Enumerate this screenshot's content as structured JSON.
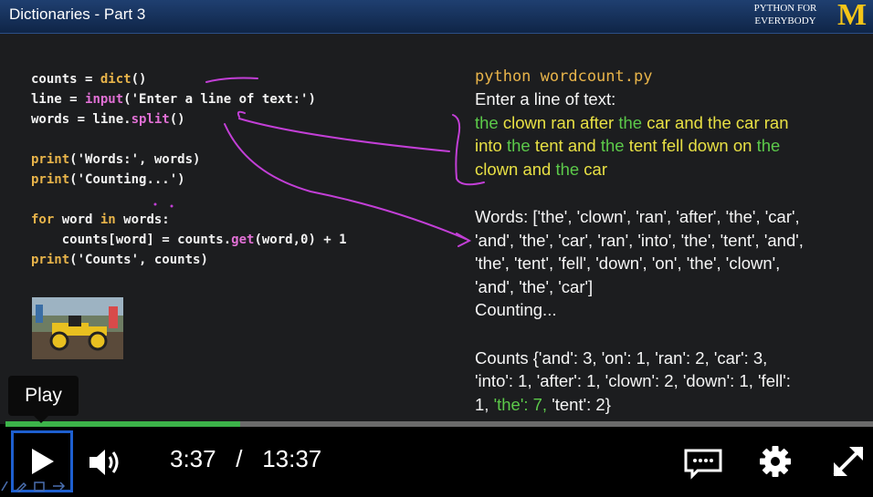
{
  "title_bar": {
    "title": "Dictionaries - Part 3",
    "brand_line1": "PYTHON FOR",
    "brand_line2": "EVERYBODY",
    "logo_letter": "M"
  },
  "code": {
    "lines": [
      [
        {
          "t": "counts = ",
          "c": "pl"
        },
        {
          "t": "dict",
          "c": "kw"
        },
        {
          "t": "()",
          "c": "pl"
        }
      ],
      [
        {
          "t": "line = ",
          "c": "pl"
        },
        {
          "t": "input",
          "c": "fn"
        },
        {
          "t": "('Enter a line of text:')",
          "c": "pl"
        }
      ],
      [
        {
          "t": "words = line.",
          "c": "pl"
        },
        {
          "t": "split",
          "c": "fn"
        },
        {
          "t": "()",
          "c": "pl"
        }
      ],
      [],
      [
        {
          "t": "print",
          "c": "kw"
        },
        {
          "t": "('Words:', words)",
          "c": "pl"
        }
      ],
      [
        {
          "t": "print",
          "c": "kw"
        },
        {
          "t": "('Counting...')",
          "c": "pl"
        }
      ],
      [],
      [
        {
          "t": "for",
          "c": "kw"
        },
        {
          "t": " word ",
          "c": "pl"
        },
        {
          "t": "in",
          "c": "kw"
        },
        {
          "t": " words:",
          "c": "pl"
        }
      ],
      [
        {
          "t": "    counts[word] = counts.",
          "c": "pl"
        },
        {
          "t": "get",
          "c": "fn"
        },
        {
          "t": "(word,0) + 1",
          "c": "pl"
        }
      ],
      [
        {
          "t": "print",
          "c": "kw"
        },
        {
          "t": "('Counts', counts)",
          "c": "pl"
        }
      ]
    ]
  },
  "output": {
    "command": "python wordcount.py",
    "lines": [
      [
        {
          "t": "Enter a line of text:",
          "c": ""
        }
      ],
      [
        {
          "t": "the",
          "c": "g"
        },
        {
          "t": " clown ran after ",
          "c": "y"
        },
        {
          "t": "the",
          "c": "g"
        },
        {
          "t": " car and the car ran",
          "c": "y"
        }
      ],
      [
        {
          "t": "into ",
          "c": "y"
        },
        {
          "t": "the",
          "c": "g"
        },
        {
          "t": " tent and ",
          "c": "y"
        },
        {
          "t": "the",
          "c": "g"
        },
        {
          "t": " tent fell down on ",
          "c": "y"
        },
        {
          "t": "the",
          "c": "g"
        }
      ],
      [
        {
          "t": "clown and ",
          "c": "y"
        },
        {
          "t": "the",
          "c": "g"
        },
        {
          "t": " car",
          "c": "y"
        }
      ],
      [],
      [
        {
          "t": "Words: ['the', 'clown', 'ran', 'after', 'the', 'car',",
          "c": ""
        }
      ],
      [
        {
          "t": "'and', 'the', 'car', 'ran', 'into', 'the', 'tent', 'and',",
          "c": ""
        }
      ],
      [
        {
          "t": "'the', 'tent', 'fell', 'down', 'on', 'the', 'clown',",
          "c": ""
        }
      ],
      [
        {
          "t": "'and', 'the', 'car']",
          "c": ""
        }
      ],
      [
        {
          "t": "Counting...",
          "c": ""
        }
      ],
      [],
      [
        {
          "t": "Counts {'and': 3, 'on': 1, 'ran': 2, 'car': 3,",
          "c": ""
        }
      ],
      [
        {
          "t": "'into': 1, 'after': 1, 'clown': 2, 'down': 1, 'fell':",
          "c": ""
        }
      ],
      [
        {
          "t": "1, ",
          "c": ""
        },
        {
          "t": "'the': 7,",
          "c": "g"
        },
        {
          "t": " 'tent': 2}",
          "c": ""
        }
      ]
    ]
  },
  "player": {
    "tooltip": "Play",
    "current_time": "3:37",
    "separator": "/",
    "duration": "13:37",
    "progress": 0.27,
    "icons": {
      "play": "play-icon",
      "volume": "volume-icon",
      "captions": "captions-icon",
      "settings": "gear-icon",
      "fullscreen": "fullscreen-icon"
    },
    "colors": {
      "progress_fill": "#3cb34a",
      "focus_ring": "#1e5fcf"
    }
  }
}
